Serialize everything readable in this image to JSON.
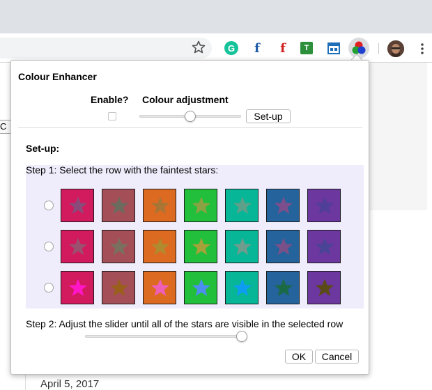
{
  "popup": {
    "title": "Colour Enhancer",
    "enable_label": "Enable?",
    "adjust_label": "Colour adjustment",
    "setup_button": "Set-up",
    "setup_heading": "Set-up:",
    "step1": "Step 1: Select the row with the faintest stars:",
    "step2": "Step 2: Adjust the slider until all of the stars are visible in the selected row",
    "ok_button": "OK",
    "cancel_button": "Cancel",
    "colour_adjustment_level": 0.5,
    "calibration_level": 1.0,
    "enabled": false
  },
  "swatch_colors": [
    "#d21a5e",
    "#a44f58",
    "#dc6a21",
    "#22bf3c",
    "#07b597",
    "#24639b",
    "#6c379e"
  ],
  "star_colors": [
    [
      "#8a4a7a",
      "#6b6b5e",
      "#a97535",
      "#8aa241",
      "#5ea08a",
      "#7d4e8c",
      "#4f3f98"
    ],
    [
      "#9b5070",
      "#7a7060",
      "#b08a2e",
      "#a4a238",
      "#709c8e",
      "#7a5088",
      "#4a4496"
    ],
    [
      "#ff16c6",
      "#9a5f1a",
      "#ee5fb8",
      "#4d8ff0",
      "#0c9df2",
      "#1b6a46",
      "#5a4a18"
    ]
  ],
  "page": {
    "date": "April 5, 2017",
    "partial_button": "C"
  },
  "browser": {
    "extension_icons": [
      "grammarly-icon",
      "facebook-icon",
      "facebook-red-icon",
      "tablet-icon",
      "calendar-icon",
      "colour-enhancer-icon"
    ]
  }
}
